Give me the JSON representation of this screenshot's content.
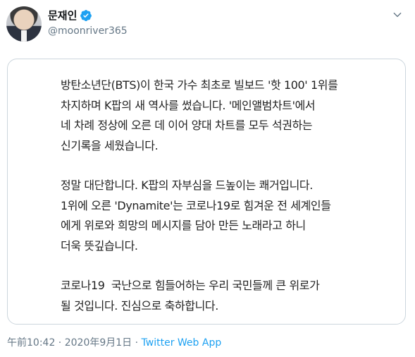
{
  "author": {
    "display_name": "문재인",
    "handle": "@moonriver365"
  },
  "tweet_image": {
    "paragraphs": [
      "방탄소년단(BTS)이 한국 가수 최초로 빌보드 '핫 100' 1위를\n차지하며 K팝의 새 역사를 썼습니다. '메인앨범차트'에서\n네 차례 정상에 오른 데 이어 양대 차트를 모두 석권하는\n신기록을 세웠습니다.",
      "정말 대단합니다. K팝의 자부심을 드높이는 쾌거입니다.\n1위에 오른 'Dynamite'는 코로나19로 힘겨운 전 세계인들\n에게 위로와 희망의 메시지를 담아 만든 노래라고 하니\n더욱 뜻깊습니다.",
      "코로나19  국난으로 힘들어하는 우리 국민들께 큰 위로가\n될 것입니다. 진심으로 축하합니다."
    ]
  },
  "meta": {
    "time": "午前10:42",
    "separator1": " · ",
    "date": "2020年9月1日",
    "separator2": " · ",
    "source": "Twitter Web App"
  },
  "icons": {
    "verified": "verified-badge-icon",
    "caret": "chevron-down-icon"
  },
  "colors": {
    "verified_blue": "#1da1f2",
    "secondary_text": "#657786",
    "border": "#ccd6dd"
  }
}
